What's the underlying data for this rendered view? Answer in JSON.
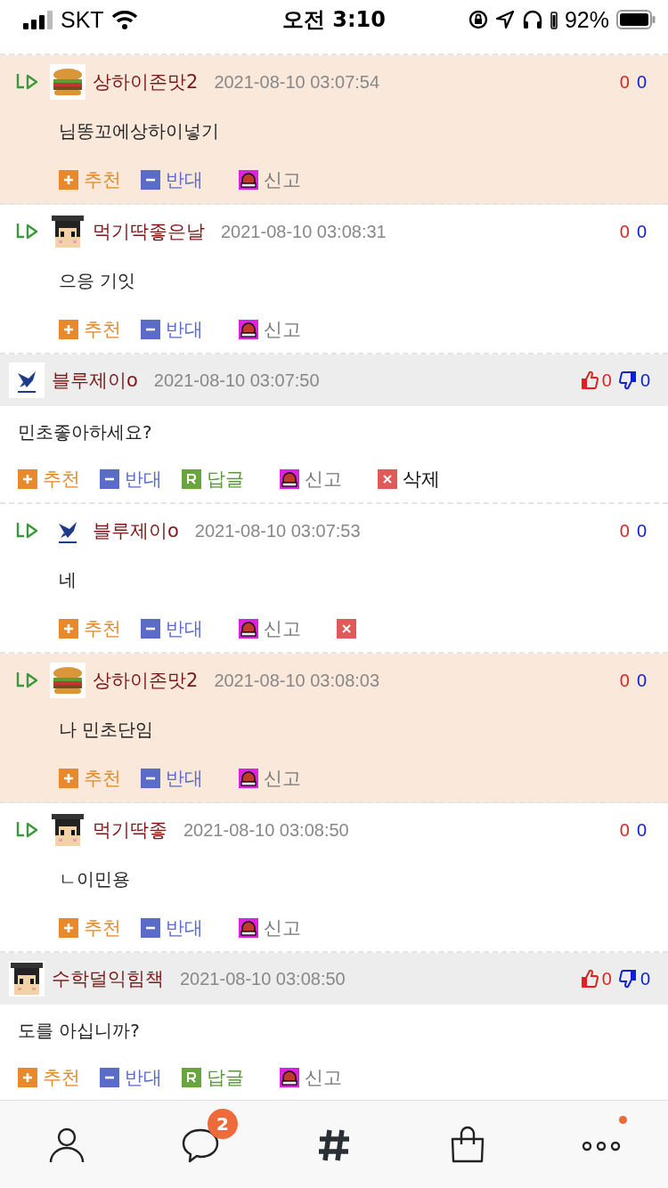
{
  "status_bar": {
    "carrier": "SKT",
    "time": "오전 3:10",
    "battery": "92%"
  },
  "comments": [
    {
      "kind": "reply",
      "highlighted": true,
      "avatar": {
        "kind": "burger"
      },
      "author": "상하이존맛2",
      "date": "2021-08-10 03:07:54",
      "up": "0",
      "down": "0",
      "body": "님똥꼬에상하이넣기",
      "actions": [
        {
          "kind": "recommend",
          "label": "추천"
        },
        {
          "kind": "oppose",
          "label": "반대"
        },
        {
          "kind": "report",
          "label": "신고"
        }
      ]
    },
    {
      "kind": "reply",
      "highlighted": false,
      "avatar": {
        "kind": "boy"
      },
      "author": "먹기딱좋은날",
      "date": "2021-08-10 03:08:31",
      "up": "0",
      "down": "0",
      "body": "으응 기잇",
      "actions": [
        {
          "kind": "recommend",
          "label": "추천"
        },
        {
          "kind": "oppose",
          "label": "반대"
        },
        {
          "kind": "report",
          "label": "신고"
        }
      ]
    },
    {
      "kind": "top",
      "highlighted": false,
      "avatar": {
        "kind": "bird"
      },
      "author": "블루제이o",
      "date": "2021-08-10 03:07:50",
      "up": "0",
      "down": "0",
      "body": "민초좋아하세요?",
      "actions": [
        {
          "kind": "recommend",
          "label": "추천"
        },
        {
          "kind": "oppose",
          "label": "반대"
        },
        {
          "kind": "reply",
          "label": "답글"
        },
        {
          "kind": "report",
          "label": "신고"
        },
        {
          "kind": "delete",
          "label": "삭제"
        }
      ]
    },
    {
      "kind": "reply",
      "highlighted": false,
      "avatar": {
        "kind": "bird"
      },
      "author": "블루제이o",
      "date": "2021-08-10 03:07:53",
      "up": "0",
      "down": "0",
      "body": "네",
      "actions": [
        {
          "kind": "recommend",
          "label": "추천"
        },
        {
          "kind": "oppose",
          "label": "반대"
        },
        {
          "kind": "report",
          "label": "신고"
        },
        {
          "kind": "delete"
        }
      ]
    },
    {
      "kind": "reply",
      "highlighted": true,
      "avatar": {
        "kind": "burger"
      },
      "author": "상하이존맛2",
      "date": "2021-08-10 03:08:03",
      "up": "0",
      "down": "0",
      "body": "나 민초단임",
      "actions": [
        {
          "kind": "recommend",
          "label": "추천"
        },
        {
          "kind": "oppose",
          "label": "반대"
        },
        {
          "kind": "report",
          "label": "신고"
        }
      ]
    },
    {
      "kind": "reply",
      "highlighted": false,
      "avatar": {
        "kind": "boy"
      },
      "author": "먹기딱좋",
      "date": "2021-08-10 03:08:50",
      "up": "0",
      "down": "0",
      "body": "ㄴ이민용",
      "actions": [
        {
          "kind": "recommend",
          "label": "추천"
        },
        {
          "kind": "oppose",
          "label": "반대"
        },
        {
          "kind": "report",
          "label": "신고"
        }
      ]
    },
    {
      "kind": "top",
      "highlighted": false,
      "avatar": {
        "kind": "boy"
      },
      "author": "수학덜익힘책",
      "date": "2021-08-10 03:08:50",
      "up": "0",
      "down": "0",
      "body": "도를 아십니까?",
      "actions": [
        {
          "kind": "recommend",
          "label": "추천"
        },
        {
          "kind": "oppose",
          "label": "반대"
        },
        {
          "kind": "reply",
          "label": "답글"
        },
        {
          "kind": "report",
          "label": "신고"
        }
      ]
    }
  ],
  "tab_bar": [
    {
      "kind": "profile"
    },
    {
      "kind": "chat",
      "badge": "2"
    },
    {
      "kind": "hashtag"
    },
    {
      "kind": "shop"
    },
    {
      "kind": "more",
      "dot": true
    }
  ]
}
